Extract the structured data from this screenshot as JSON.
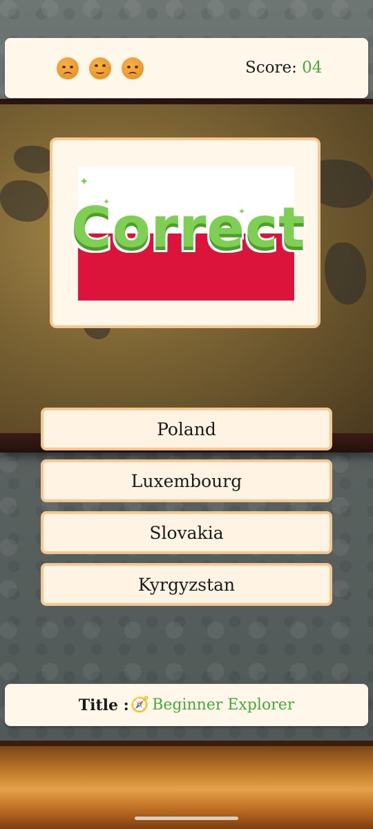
{
  "header": {
    "lives": [
      "unamused-face-icon",
      "rolling-eyes-face-icon",
      "sad-face-icon"
    ],
    "score_label": "Score:",
    "score_value": "04"
  },
  "question": {
    "flag_colors": [
      "#ffffff",
      "#dc143c"
    ],
    "feedback_text": "Correct"
  },
  "answers": [
    {
      "label": "Poland"
    },
    {
      "label": "Luxembourg"
    },
    {
      "label": "Slovakia"
    },
    {
      "label": "Kyrgyzstan"
    }
  ],
  "footer": {
    "title_label": "Title :",
    "title_icon": "compass-icon",
    "title_value": "Beginner Explorer"
  },
  "colors": {
    "accent_green": "#46a83a",
    "card_border": "#f6c790",
    "card_bg": "#fff8ea"
  }
}
